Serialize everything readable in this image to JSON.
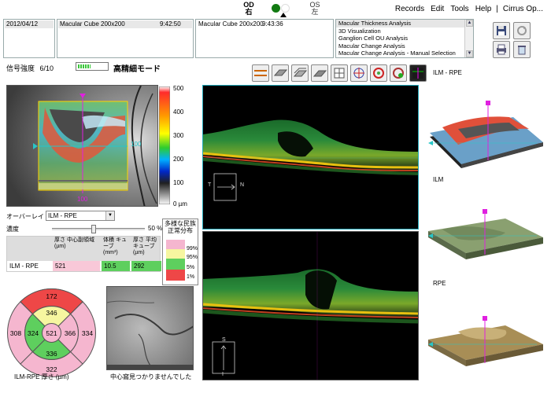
{
  "menu": [
    "Records",
    "Edit",
    "Tools",
    "Help",
    "|",
    "Cirrus Op..."
  ],
  "eye": {
    "od_label": "OD",
    "od_sub": "右",
    "os_label": "OS",
    "os_sub": "左"
  },
  "exam": {
    "date": "2012/04/12",
    "scan1_name": "Macular Cube 200x200",
    "scan1_time": "9:42:50",
    "scan2_name": "Macular Cube 200x200",
    "scan2_time": "9:43:36"
  },
  "analysis_list": [
    "Macular Thickness Analysis",
    "3D Visualization",
    "Ganglion Cell OU Analysis",
    "Macular Change Analysis",
    "Macular Change Analysis - Manual Selection"
  ],
  "analysis_selected_index": 0,
  "signal": {
    "label": "信号強度",
    "value": "6/10",
    "fraction": 0.6
  },
  "hd_mode_label": "高精細モード",
  "colorbar": {
    "ticks": [
      "500",
      "400",
      "300",
      "200",
      "100",
      "0 µm"
    ]
  },
  "fundus": {
    "right_marker": "100",
    "bottom_marker": "100"
  },
  "overlay": {
    "label": "オーバーレイ",
    "value": "ILM - RPE"
  },
  "density": {
    "label": "濃度",
    "value": "50 %",
    "fraction": 0.5
  },
  "metrics": {
    "headers": [
      "厚さ 中心副領域 (µm)",
      "体積 キューブ (mm³)",
      "厚さ 平均 キューブ (µm)"
    ],
    "row_label": "ILM - RPE",
    "values": [
      "521",
      "10.5",
      "292"
    ]
  },
  "distribution": {
    "title": "多様な民族 正常分布",
    "levels": [
      {
        "label": "99%",
        "color": "#f5b6cf"
      },
      {
        "label": "95%",
        "color": "#f6f6a0"
      },
      {
        "label": "5%",
        "color": "#5ecf5e"
      },
      {
        "label": "1%",
        "color": "#ee4747"
      }
    ]
  },
  "etdrs": {
    "center": "521",
    "inner_top": "346",
    "inner_left": "324",
    "inner_right": "366",
    "inner_bottom": "336",
    "outer_top": "172",
    "outer_left": "308",
    "outer_right": "334",
    "outer_bottom": "322",
    "caption": "ILM-RPE 厚さ (µm)"
  },
  "slo_caption": "中心窩見つかりませんでした",
  "bscan1": {
    "left": "T",
    "right": "N"
  },
  "bscan2": {
    "top": "S",
    "bottom": "I"
  },
  "views3d": {
    "a": "ILM - RPE",
    "b": "ILM",
    "c": "RPE"
  },
  "colors": {
    "accent_cyan": "#28c6c8",
    "marker_magenta": "#e020e0",
    "panel_border": "#99aaaa"
  },
  "icons": {
    "save": "floppy-disk-icon",
    "refresh": "refresh-icon",
    "print": "printer-icon",
    "delete": "trash-icon"
  }
}
